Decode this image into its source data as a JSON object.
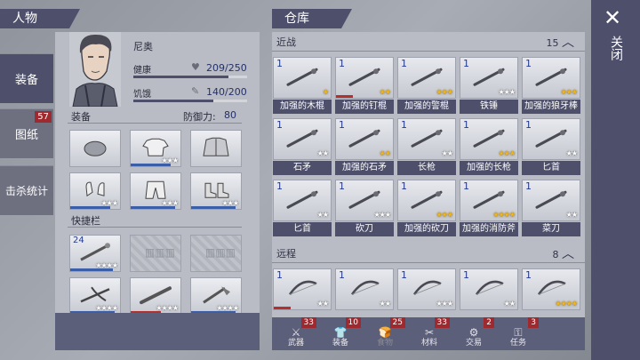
{
  "header": {
    "character_title": "人物",
    "storage_title": "仓库",
    "close_label": "关闭"
  },
  "left_tabs": [
    {
      "label": "装备",
      "active": true
    },
    {
      "label": "图纸",
      "badge": "57"
    },
    {
      "label": "击杀统计"
    }
  ],
  "character": {
    "name": "尼奥",
    "health_label": "健康",
    "health_value": "209/250",
    "health_fraction": 0.836,
    "hunger_label": "饥饿",
    "hunger_value": "140/200",
    "hunger_fraction": 0.7
  },
  "equipment": {
    "title": "装备",
    "defense_label": "防御力:",
    "defense_value": "80",
    "slots": [
      {
        "icon": "cap-icon",
        "stars": "",
        "usage": 0
      },
      {
        "icon": "shirt-icon",
        "stars": "★★★",
        "usage": 0.8
      },
      {
        "icon": "jacket-icon",
        "stars": "",
        "usage": 0
      },
      {
        "icon": "gloves-icon",
        "stars": "★★★",
        "usage": 0.8
      },
      {
        "icon": "pants-icon",
        "stars": "★★★",
        "usage": 0.9
      },
      {
        "icon": "boots-icon",
        "stars": "★★★",
        "usage": 0.9
      }
    ]
  },
  "quickbar": {
    "title": "快捷栏",
    "slots": [
      {
        "count": "24",
        "icon": "spiked-club-icon",
        "stars": "★★★★",
        "locked": false,
        "usage": 0.85
      },
      {
        "locked": true
      },
      {
        "locked": true
      },
      {
        "icon": "crossbow-icon",
        "stars": "★★★★",
        "locked": false,
        "usage": 0.9
      },
      {
        "icon": "bat-icon",
        "stars": "★★★★",
        "locked": false,
        "usage": 0.6
      },
      {
        "icon": "hatchet-icon",
        "stars": "★★★★",
        "locked": false,
        "usage": 0.9
      }
    ]
  },
  "storage": {
    "melee": {
      "title": "近战",
      "count": "15",
      "items": [
        {
          "count": "1",
          "label": "加强的木棍",
          "stars": "★",
          "gold": true,
          "usage": 0
        },
        {
          "count": "1",
          "label": "加强的钉棍",
          "stars": "★★",
          "gold": true,
          "usage": 0.3
        },
        {
          "count": "1",
          "label": "加强的警棍",
          "stars": "★★★",
          "gold": true,
          "usage": 0
        },
        {
          "count": "1",
          "label": "铁锤",
          "stars": "★★★",
          "gold": false,
          "usage": 0
        },
        {
          "count": "1",
          "label": "加强的狼牙棒",
          "stars": "★★★",
          "gold": true,
          "usage": 0
        },
        {
          "count": "1",
          "label": "石矛",
          "stars": "★★",
          "gold": false,
          "usage": 0
        },
        {
          "count": "1",
          "label": "加强的石矛",
          "stars": "★★",
          "gold": true,
          "usage": 0
        },
        {
          "count": "1",
          "label": "长枪",
          "stars": "★★",
          "gold": false,
          "usage": 0
        },
        {
          "count": "1",
          "label": "加强的长枪",
          "stars": "★★★",
          "gold": true,
          "usage": 0
        },
        {
          "count": "1",
          "label": "匕首",
          "stars": "★★",
          "gold": false,
          "usage": 0
        },
        {
          "count": "1",
          "label": "匕首",
          "stars": "★★",
          "gold": false,
          "usage": 0
        },
        {
          "count": "1",
          "label": "砍刀",
          "stars": "★★★",
          "gold": false,
          "usage": 0
        },
        {
          "count": "1",
          "label": "加强的砍刀",
          "stars": "★★★",
          "gold": true,
          "usage": 0
        },
        {
          "count": "1",
          "label": "加强的消防斧",
          "stars": "★★★★",
          "gold": true,
          "usage": 0
        },
        {
          "count": "1",
          "label": "菜刀",
          "stars": "★★",
          "gold": false,
          "usage": 0
        }
      ]
    },
    "ranged": {
      "title": "远程",
      "count": "8",
      "items": [
        {
          "count": "1",
          "stars": "★★",
          "gold": false,
          "usage": 0.3
        },
        {
          "count": "1",
          "stars": "★★",
          "gold": false,
          "usage": 0
        },
        {
          "count": "1",
          "stars": "★★★",
          "gold": false,
          "usage": 0
        },
        {
          "count": "1",
          "stars": "★★",
          "gold": false,
          "usage": 0
        },
        {
          "count": "1",
          "stars": "★★★★",
          "gold": true,
          "usage": 0
        }
      ]
    },
    "tabs": [
      {
        "label": "武器",
        "count": "33"
      },
      {
        "label": "装备",
        "count": "10"
      },
      {
        "label": "食物",
        "count": "25"
      },
      {
        "label": "材料",
        "count": "33"
      },
      {
        "label": "交易",
        "count": "2"
      },
      {
        "label": "任务",
        "count": "3"
      }
    ]
  },
  "colors": {
    "accent": "#4d4f6b",
    "badge": "#9e2a2f",
    "usage_bar": "#3b5ea8",
    "usage_bar_red": "#b3312c",
    "star_gold": "#f5b70f"
  }
}
